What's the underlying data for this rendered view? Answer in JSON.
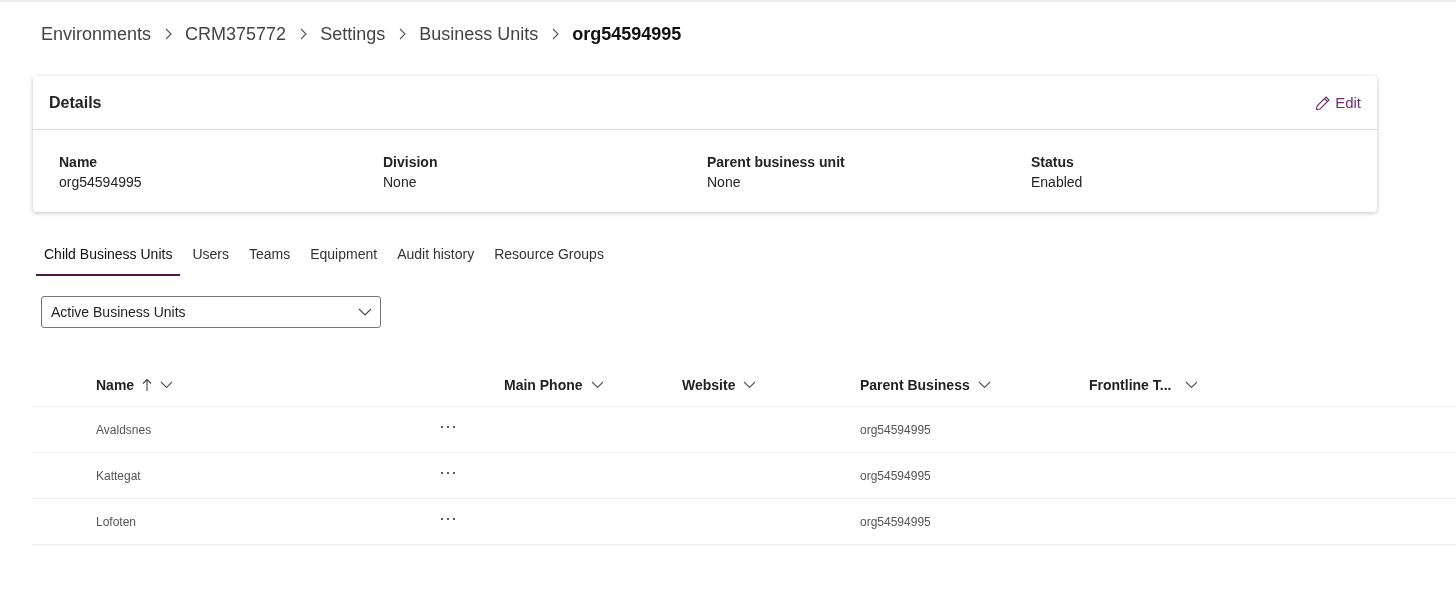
{
  "breadcrumb": [
    {
      "label": "Environments",
      "current": false
    },
    {
      "label": "CRM375772",
      "current": false
    },
    {
      "label": "Settings",
      "current": false
    },
    {
      "label": "Business Units",
      "current": false
    },
    {
      "label": "org54594995",
      "current": true
    }
  ],
  "details": {
    "title": "Details",
    "edit_label": "Edit",
    "fields": [
      {
        "label": "Name",
        "value": "org54594995"
      },
      {
        "label": "Division",
        "value": "None"
      },
      {
        "label": "Parent business unit",
        "value": "None"
      },
      {
        "label": "Status",
        "value": "Enabled"
      }
    ]
  },
  "tabs": [
    {
      "label": "Child Business Units",
      "selected": true
    },
    {
      "label": "Users",
      "selected": false
    },
    {
      "label": "Teams",
      "selected": false
    },
    {
      "label": "Equipment",
      "selected": false
    },
    {
      "label": "Audit history",
      "selected": false
    },
    {
      "label": "Resource Groups",
      "selected": false
    }
  ],
  "view_selector": {
    "value": "Active Business Units"
  },
  "table": {
    "columns": [
      {
        "label": "Name",
        "sorted": true
      },
      {
        "label": "Main Phone",
        "sorted": false
      },
      {
        "label": "Website",
        "sorted": false
      },
      {
        "label": "Parent Business",
        "sorted": false
      },
      {
        "label": "Frontline T...",
        "sorted": false
      }
    ],
    "rows": [
      {
        "name": "Avaldsnes",
        "parent": "org54594995"
      },
      {
        "name": "Kattegat",
        "parent": "org54594995"
      },
      {
        "name": "Lofoten",
        "parent": "org54594995"
      }
    ]
  }
}
